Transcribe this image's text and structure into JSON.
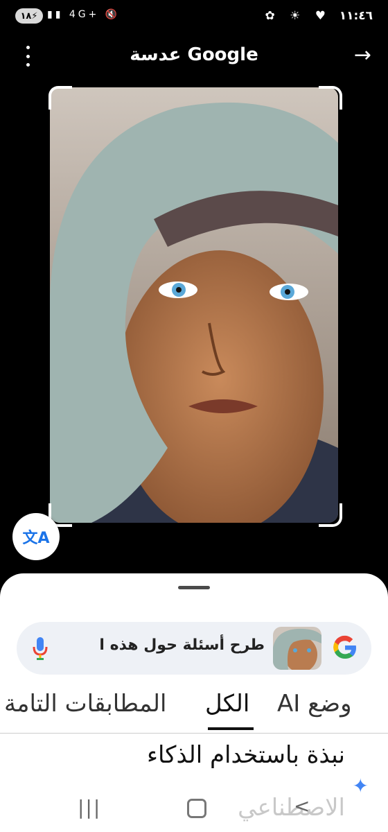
{
  "status": {
    "time": "١١:٤٦",
    "battery": "١٨",
    "network": "4G+"
  },
  "header": {
    "title": "عدسة Google"
  },
  "search": {
    "query_text": "طرح أسئلة حول هذه ا"
  },
  "tabs": [
    {
      "label": "وضع AI"
    },
    {
      "label": "الكل"
    },
    {
      "label": "المطابقات التامة"
    }
  ],
  "ai_overview": {
    "line1": "نبذة باستخدام الذكاء",
    "line2": "الاصطناعي"
  },
  "colors": {
    "accent": "#1a73e8",
    "google_blue": "#4285f4",
    "google_red": "#ea4335",
    "google_yellow": "#fbbc05",
    "google_green": "#34a853"
  },
  "icons": [
    "more-vert-icon",
    "arrow-forward-icon",
    "translate-icon",
    "google-g-icon",
    "mic-icon",
    "sparkle-icon",
    "recents-icon",
    "home-icon",
    "back-icon"
  ]
}
